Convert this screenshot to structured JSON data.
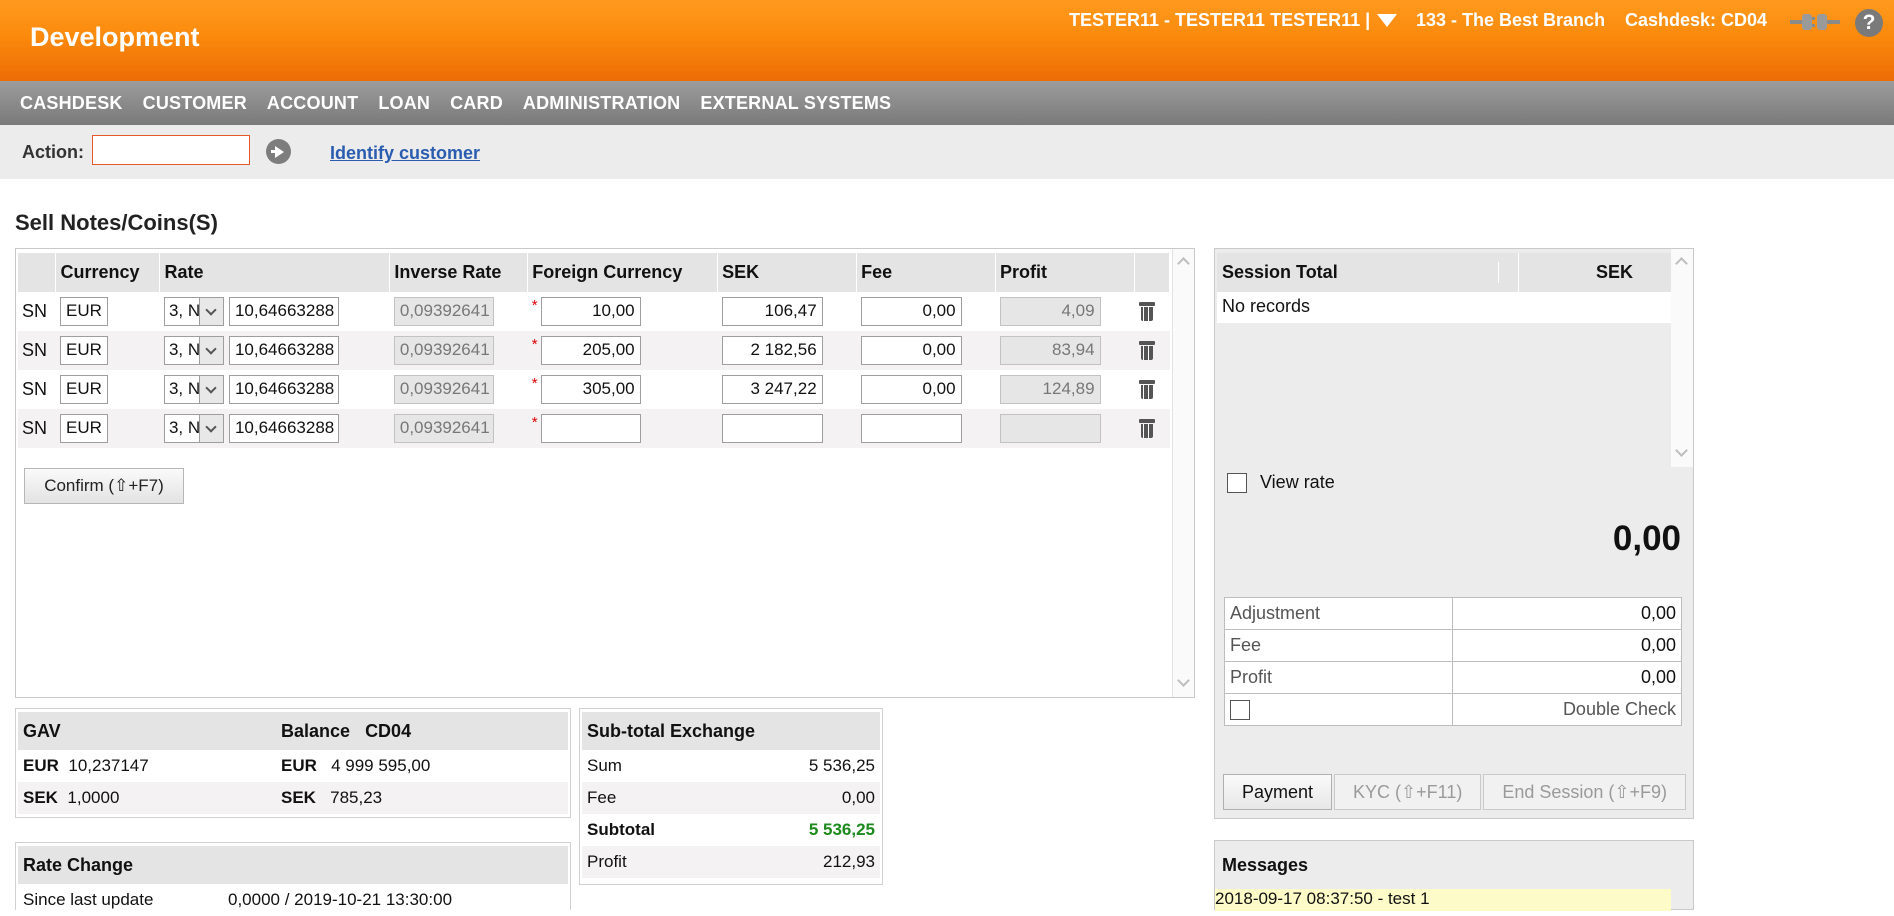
{
  "header": {
    "app_title": "Development",
    "user": "TESTER11 - TESTER11 TESTER11 |",
    "branch": "133 - The Best Branch",
    "cashdesk": "Cashdesk: CD04",
    "help": "?"
  },
  "menu": [
    "CASHDESK",
    "CUSTOMER",
    "ACCOUNT",
    "LOAN",
    "CARD",
    "ADMINISTRATION",
    "EXTERNAL SYSTEMS"
  ],
  "action_bar": {
    "label": "Action:",
    "input_value": "",
    "identify_link": "Identify customer"
  },
  "page_title": "Sell Notes/Coins(S)",
  "grid": {
    "columns": [
      "",
      "Currency",
      "Rate",
      "Inverse Rate",
      "Foreign Currency",
      "SEK",
      "Fee",
      "Profit",
      ""
    ],
    "rows": [
      {
        "type": "SN",
        "currency": "EUR",
        "rate_select": "3, N",
        "rate": "10,64663288",
        "inverse_rate": "0,09392641",
        "foreign_currency": "10,00",
        "sek": "106,47",
        "fee": "0,00",
        "profit": "4,09"
      },
      {
        "type": "SN",
        "currency": "EUR",
        "rate_select": "3, N",
        "rate": "10,64663288",
        "inverse_rate": "0,09392641",
        "foreign_currency": "205,00",
        "sek": "2 182,56",
        "fee": "0,00",
        "profit": "83,94"
      },
      {
        "type": "SN",
        "currency": "EUR",
        "rate_select": "3, N",
        "rate": "10,64663288",
        "inverse_rate": "0,09392641",
        "foreign_currency": "305,00",
        "sek": "3 247,22",
        "fee": "0,00",
        "profit": "124,89"
      },
      {
        "type": "SN",
        "currency": "EUR",
        "rate_select": "3, N",
        "rate": "10,64663288",
        "inverse_rate": "0,09392641",
        "foreign_currency": "",
        "sek": "",
        "fee": "",
        "profit": ""
      }
    ],
    "required_mark": "*",
    "confirm_label": "Confirm (⇧+F7)"
  },
  "gav": {
    "head": "GAV",
    "balance_head": "Balance",
    "balance_desk": "CD04",
    "rows": [
      {
        "cur": "EUR",
        "gav": "10,237147",
        "bal_cur": "EUR",
        "balance": "4 999 595,00"
      },
      {
        "cur": "SEK",
        "gav": "1,0000",
        "bal_cur": "SEK",
        "balance": "785,23"
      }
    ]
  },
  "rate_change": {
    "head": "Rate Change",
    "row_label": "Since last update",
    "row_value": "0,0000 / 2019-10-21 13:30:00"
  },
  "subtotal": {
    "head": "Sub-total Exchange",
    "rows": [
      {
        "label": "Sum",
        "value": "5 536,25"
      },
      {
        "label": "Fee",
        "value": "0,00"
      },
      {
        "label": "Subtotal",
        "value": "5 536,25"
      },
      {
        "label": "Profit",
        "value": "212,93"
      }
    ]
  },
  "session": {
    "head_total": "Session Total",
    "head_sek": "SEK",
    "no_records": "No records",
    "view_rate": "View rate",
    "big_total": "0,00",
    "adjustments": [
      {
        "label": "Adjustment",
        "value": "0,00"
      },
      {
        "label": "Fee",
        "value": "0,00"
      },
      {
        "label": "Profit",
        "value": "0,00"
      }
    ],
    "double_check": "Double Check",
    "buttons": {
      "payment": "Payment",
      "kyc": "KYC (⇧+F11)",
      "end_session": "End Session (⇧+F9)"
    }
  },
  "messages": {
    "title": "Messages",
    "items": [
      "2018-09-17 08:37:50 - test 1"
    ]
  }
}
